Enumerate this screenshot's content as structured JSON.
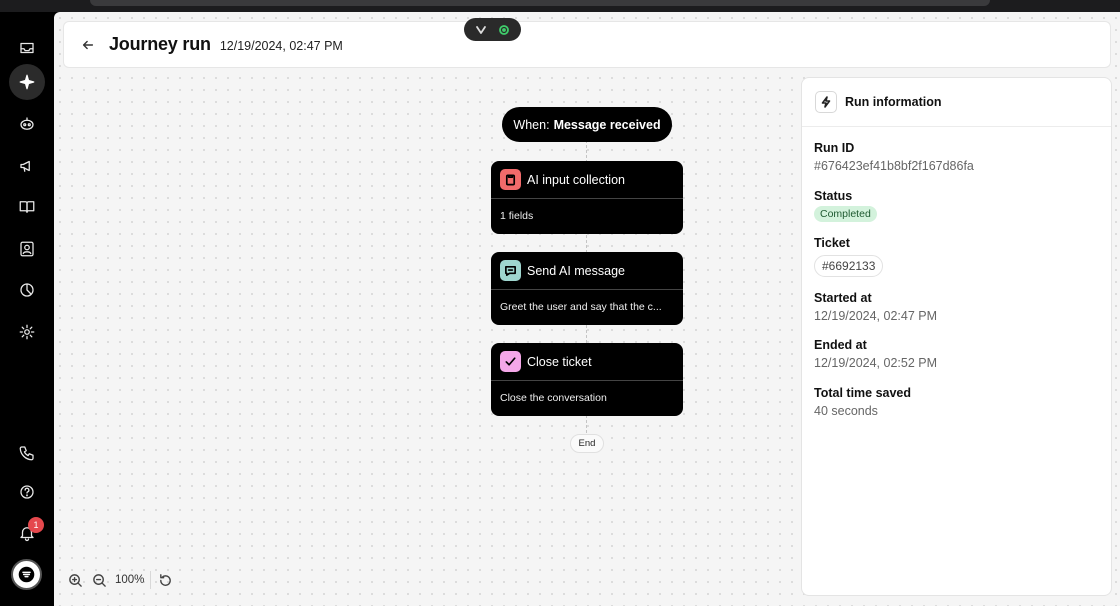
{
  "header": {
    "title": "Journey run",
    "timestamp": "12/19/2024, 02:47 PM"
  },
  "sidebar": {
    "items": [
      {
        "icon": "inbox-icon"
      },
      {
        "icon": "sparkle-icon",
        "active": true
      },
      {
        "icon": "bot-icon"
      },
      {
        "icon": "megaphone-icon"
      },
      {
        "icon": "book-icon"
      },
      {
        "icon": "contact-icon"
      },
      {
        "icon": "chart-pie-icon"
      },
      {
        "icon": "gear-icon"
      }
    ],
    "bottom": [
      {
        "icon": "phone-icon"
      },
      {
        "icon": "help-icon"
      },
      {
        "icon": "bell-icon"
      }
    ],
    "notification_count": "1"
  },
  "flow": {
    "trigger_prefix": "When:",
    "trigger_value": "Message received",
    "nodes": [
      {
        "title": "AI input collection",
        "detail": "1 fields",
        "icon": "clipboard-icon",
        "color": "#f26b6b"
      },
      {
        "title": "Send AI message",
        "detail": "Greet the user and say that the c...",
        "icon": "chat-icon",
        "color": "#9fd6cf"
      },
      {
        "title": "Close ticket",
        "detail": "Close the conversation",
        "icon": "check-icon",
        "color": "#f4a7e8"
      }
    ],
    "end_label": "End"
  },
  "zoom": {
    "level": "100%"
  },
  "run_info": {
    "title": "Run information",
    "run_id_label": "Run ID",
    "run_id": "#676423ef41b8bf2f167d86fa",
    "status_label": "Status",
    "status": "Completed",
    "ticket_label": "Ticket",
    "ticket": "#6692133",
    "started_label": "Started at",
    "started": "12/19/2024, 02:47 PM",
    "ended_label": "Ended at",
    "ended": "12/19/2024, 02:52 PM",
    "saved_label": "Total time saved",
    "saved": "40 seconds"
  },
  "colors": {
    "status_bg": "#d3f2dc",
    "badge": "#e5484d",
    "sidebar": "#000000"
  }
}
